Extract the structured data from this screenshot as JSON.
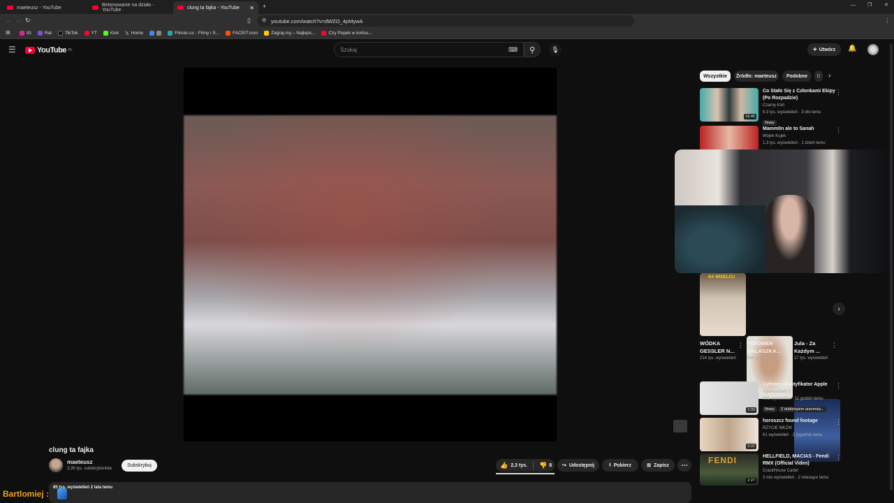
{
  "tabs": [
    {
      "title": "maeteusz - YouTube"
    },
    {
      "title": "Betonowanie na działo - YouTube"
    },
    {
      "title": "clung ta fajka - YouTube",
      "active": true
    }
  ],
  "address": {
    "url": "youtube.com/watch?v=dWZO_4pMywA"
  },
  "bookmarks": [
    "IG",
    "Rat",
    "TikTok",
    "YT",
    "Kick",
    "Home",
    "",
    "Filman.cc - Filmy i S...",
    "FACEIT.com",
    "Zagraj.my – Najleps...",
    "Czy Popek w końcu..."
  ],
  "header": {
    "logo": "YouTube",
    "region": "PL",
    "search_placeholder": "Szukaj",
    "create_label": "Utwórz"
  },
  "chips": [
    "Wszystkie",
    "Źródło: maeteusz",
    "Podobne",
    "D"
  ],
  "video": {
    "title": "clung ta fajka",
    "channel": "maeteusz",
    "subs": "3,35 tys. subskrybentów",
    "subscribe": "Subskrybuj",
    "likes": "2,3 tys.",
    "dislikes": "8",
    "share": "Udostępnij",
    "download": "Pobierz",
    "save": "Zapisz",
    "views_partial": "85 tys. wyświetleń  2 lata temu"
  },
  "recs_top": [
    {
      "title": "Co Stało Się z Członkami Ekipy (Po Rozpadzie)",
      "channel": "Czarny Koń",
      "meta": "6,3 tys. wyświetleń · 3 dni temu",
      "badge": "Nowy",
      "duration": "16:45"
    },
    {
      "title": "Mamm0n ale to Sanah",
      "channel": "Wojek Kujek",
      "meta": "1,3 tys. wyświetleń · 1 dzień temu"
    }
  ],
  "shorts": [
    {
      "title": "WÓDKA GESSLER N...",
      "views": "214 tys. wyświetleń",
      "overlay": "NA WIDELCU"
    },
    {
      "title": "FENOMEN WALASZKA...",
      "views": "894 tys. wyświetleń"
    },
    {
      "title": "Jula - Za Każdym ...",
      "views": "17 tys. wyświetleń"
    }
  ],
  "recs_bottom": [
    {
      "title": "Cyfrowy identyfikator Apple",
      "channel": "7gramsofsalt 3",
      "meta": "805 wyświetleń · 11 godzin temu",
      "badge": "Nowy",
      "badge2": "Z dubbingiem automaty...",
      "duration": "2:33"
    },
    {
      "title": "horoszcz found footage",
      "channel": "RZYCIE MKZW",
      "meta": "61 wyświetleń · 2 tygodnie temu",
      "duration": "3:37"
    },
    {
      "title": "HELLFIELD, MACIAS - Fendi RMX (Official Video)",
      "channel": "CrackHouse Cartel",
      "meta": "3 min wyświetleń · 2 miesiące temu",
      "duration": "2:27",
      "thumb_text": "FENDI"
    }
  ],
  "overlay": {
    "chat_user": "Bartlomiej :"
  },
  "colors": {
    "bg": "#0f0f0f",
    "accent": "#ff0033",
    "chrome": "#303030"
  }
}
